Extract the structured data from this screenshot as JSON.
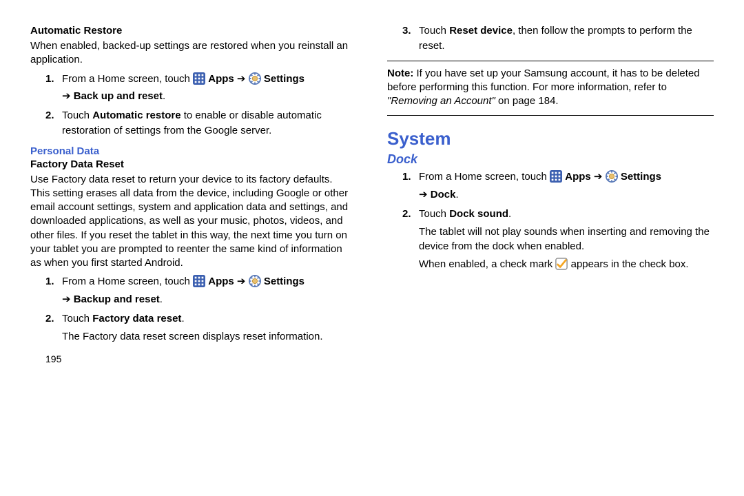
{
  "left": {
    "auto_restore": {
      "title": "Automatic Restore",
      "desc": "When enabled, backed-up settings are restored when you reinstall an application.",
      "step1_a": "From a Home screen, touch ",
      "step1_apps": " Apps ",
      "step1_settings": " Settings ",
      "step1_b": "Back up and reset",
      "step2_a": "Touch ",
      "step2_b": "Automatic restore",
      "step2_c": " to enable or disable automatic restoration of settings from the Google server."
    },
    "personal_data": {
      "heading": "Personal Data",
      "fdr_title": "Factory Data Reset",
      "fdr_desc": "Use Factory data reset to return your device to its factory defaults. This setting erases all data from the device, including Google or other email account settings, system and application data and settings, and downloaded applications, as well as your music, photos, videos, and other files. If you reset the tablet in this way, the next time you turn on your tablet you are prompted to reenter the same kind of information as when you first started Android.",
      "step1_a": "From a Home screen, touch ",
      "step1_apps": " Apps ",
      "step1_settings": " Settings ",
      "step1_b": "Backup and reset",
      "step2_a": "Touch ",
      "step2_b": "Factory data reset",
      "step2_c": ".",
      "step2_sub": "The Factory data reset screen displays reset information."
    },
    "page_num": "195"
  },
  "right": {
    "step3_a": "Touch ",
    "step3_b": "Reset device",
    "step3_c": ", then follow the prompts to perform the reset.",
    "note_label": "Note:",
    "note_a": " If you have set up your Samsung account, it has to be deleted before performing this function. For more information, refer to ",
    "note_ref": "\"Removing an Account\"",
    "note_b": "  on page 184.",
    "system": {
      "title": "System",
      "dock": {
        "title": "Dock",
        "step1_a": "From a Home screen, touch ",
        "step1_apps": " Apps ",
        "step1_settings": " Settings ",
        "step1_b": "Dock",
        "step2_a": "Touch ",
        "step2_b": "Dock sound",
        "step2_c": ".",
        "step2_sub": "The tablet will not play sounds when inserting and removing the device from the dock when enabled.",
        "step2_sub2a": "When enabled, a check mark ",
        "step2_sub2b": " appears in the check box."
      }
    }
  },
  "glyphs": {
    "arrow_right": "➔",
    "arrow_sub": "➔"
  }
}
